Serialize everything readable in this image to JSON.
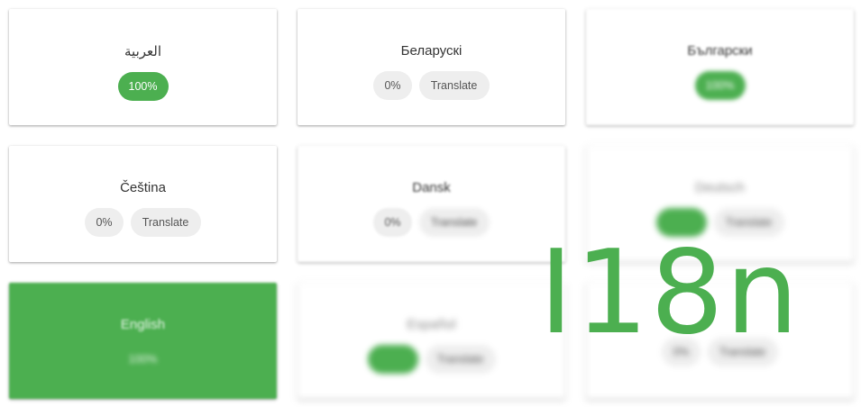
{
  "title": "I18n",
  "accent_color": "#4caf50",
  "languages": [
    {
      "name": "العربية",
      "percent": "100%",
      "translate_label": ""
    },
    {
      "name": "Беларускі",
      "percent": "0%",
      "translate_label": "Translate"
    },
    {
      "name": "Български",
      "percent": "100%",
      "translate_label": ""
    },
    {
      "name": "Čeština",
      "percent": "0%",
      "translate_label": "Translate"
    },
    {
      "name": "Dansk",
      "percent": "0%",
      "translate_label": "Translate"
    },
    {
      "name": "Deutsch",
      "percent": "",
      "translate_label": "Translate"
    },
    {
      "name": "English",
      "percent": "100%",
      "translate_label": ""
    },
    {
      "name": "Español",
      "percent": "",
      "translate_label": "Translate"
    },
    {
      "name": "",
      "percent": "0%",
      "translate_label": "Translate"
    }
  ]
}
